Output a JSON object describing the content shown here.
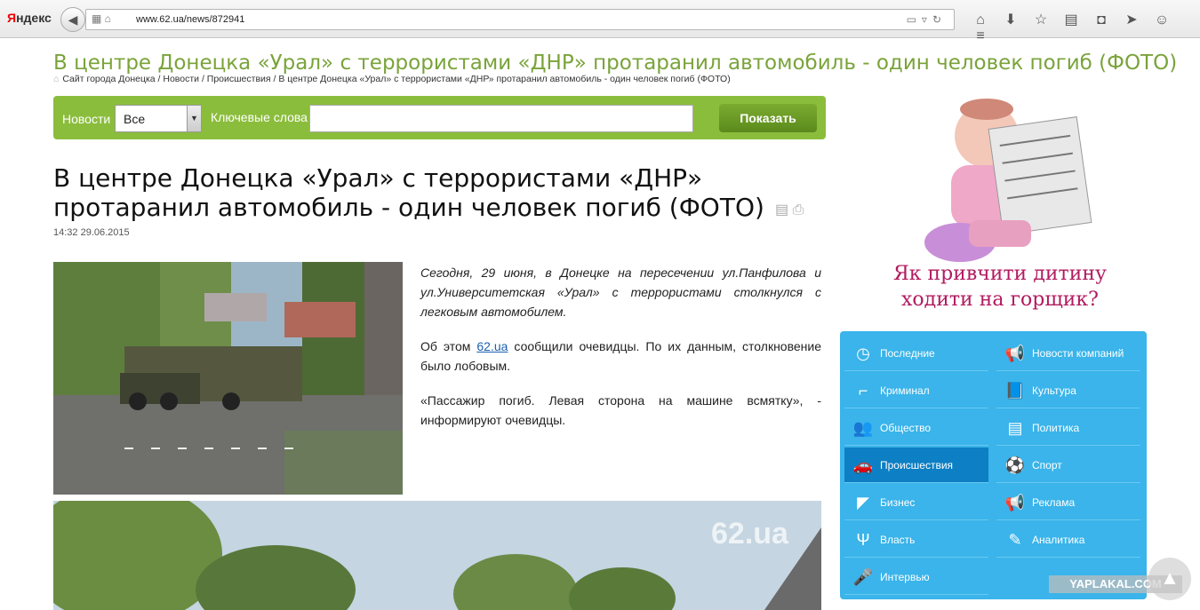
{
  "browser": {
    "logo_y": "Я",
    "logo_rest": "ндекс",
    "url": "www.62.ua/news/872941"
  },
  "page": {
    "header_title": "В центре Донецка «Урал» с террористами «ДНР» протаранил автомобиль - один человек погиб (ФОТО)",
    "breadcrumb": "Сайт города Донецка / Новости / Происшествия / В центре Донецка «Урал» с террористами «ДНР» протаранил автомобиль - один человек погиб (ФОТО)"
  },
  "search": {
    "news_label": "Новости",
    "select_value": "Все",
    "keywords_label": "Ключевые слова",
    "keywords_value": "",
    "button_label": "Показать"
  },
  "article": {
    "title": "В центре Донецка «Урал» с террористами «ДНР» протаранил автомобиль - один человек погиб (ФОТО)",
    "date": "14:32 29.06.2015",
    "p1": "Сегодня, 29 июня, в Донецке на пересечении ул.Панфилова и ул.Университетская «Урал» с террористами столкнулся с легковым автомобилем.",
    "p2_before": "Об этом ",
    "p2_link": "62.ua",
    "p2_after": " сообщили очевидцы. По их данным, столкновение было лобовым.",
    "p3": "«Пассажир погиб. Левая сторона на машине всмятку», - информируют очевидцы.",
    "photo_watermark": "62.ua"
  },
  "ad": {
    "text": "Як привчити дитину ходити на горщик?"
  },
  "categories": [
    {
      "label": "Последние",
      "icon": "clock-icon",
      "glyph": "◷"
    },
    {
      "label": "Новости компаний",
      "icon": "megaphone-icon",
      "glyph": "📢"
    },
    {
      "label": "Криминал",
      "icon": "gun-icon",
      "glyph": "⌐"
    },
    {
      "label": "Культура",
      "icon": "book-icon",
      "glyph": "📘"
    },
    {
      "label": "Общество",
      "icon": "people-icon",
      "glyph": "👥"
    },
    {
      "label": "Политика",
      "icon": "document-icon",
      "glyph": "▤"
    },
    {
      "label": "Происшествия",
      "icon": "car-icon",
      "glyph": "🚗"
    },
    {
      "label": "Спорт",
      "icon": "ball-icon",
      "glyph": "⚽"
    },
    {
      "label": "Бизнес",
      "icon": "chart-icon",
      "glyph": "◤"
    },
    {
      "label": "Реклама",
      "icon": "megaphone-icon",
      "glyph": "📢"
    },
    {
      "label": "Власть",
      "icon": "trident-icon",
      "glyph": "Ψ"
    },
    {
      "label": "Аналитика",
      "icon": "pen-icon",
      "glyph": "✎"
    },
    {
      "label": "Интервью",
      "icon": "microphone-icon",
      "glyph": "🎤"
    }
  ],
  "overlay": {
    "watermark": "YAPLAKAL.COM"
  },
  "colors": {
    "accent_green": "#8bbd3c",
    "title_green": "#7aa33a",
    "category_blue": "#3ab4ea",
    "category_active": "#0d7fc4",
    "ad_text": "#b21a5f"
  }
}
